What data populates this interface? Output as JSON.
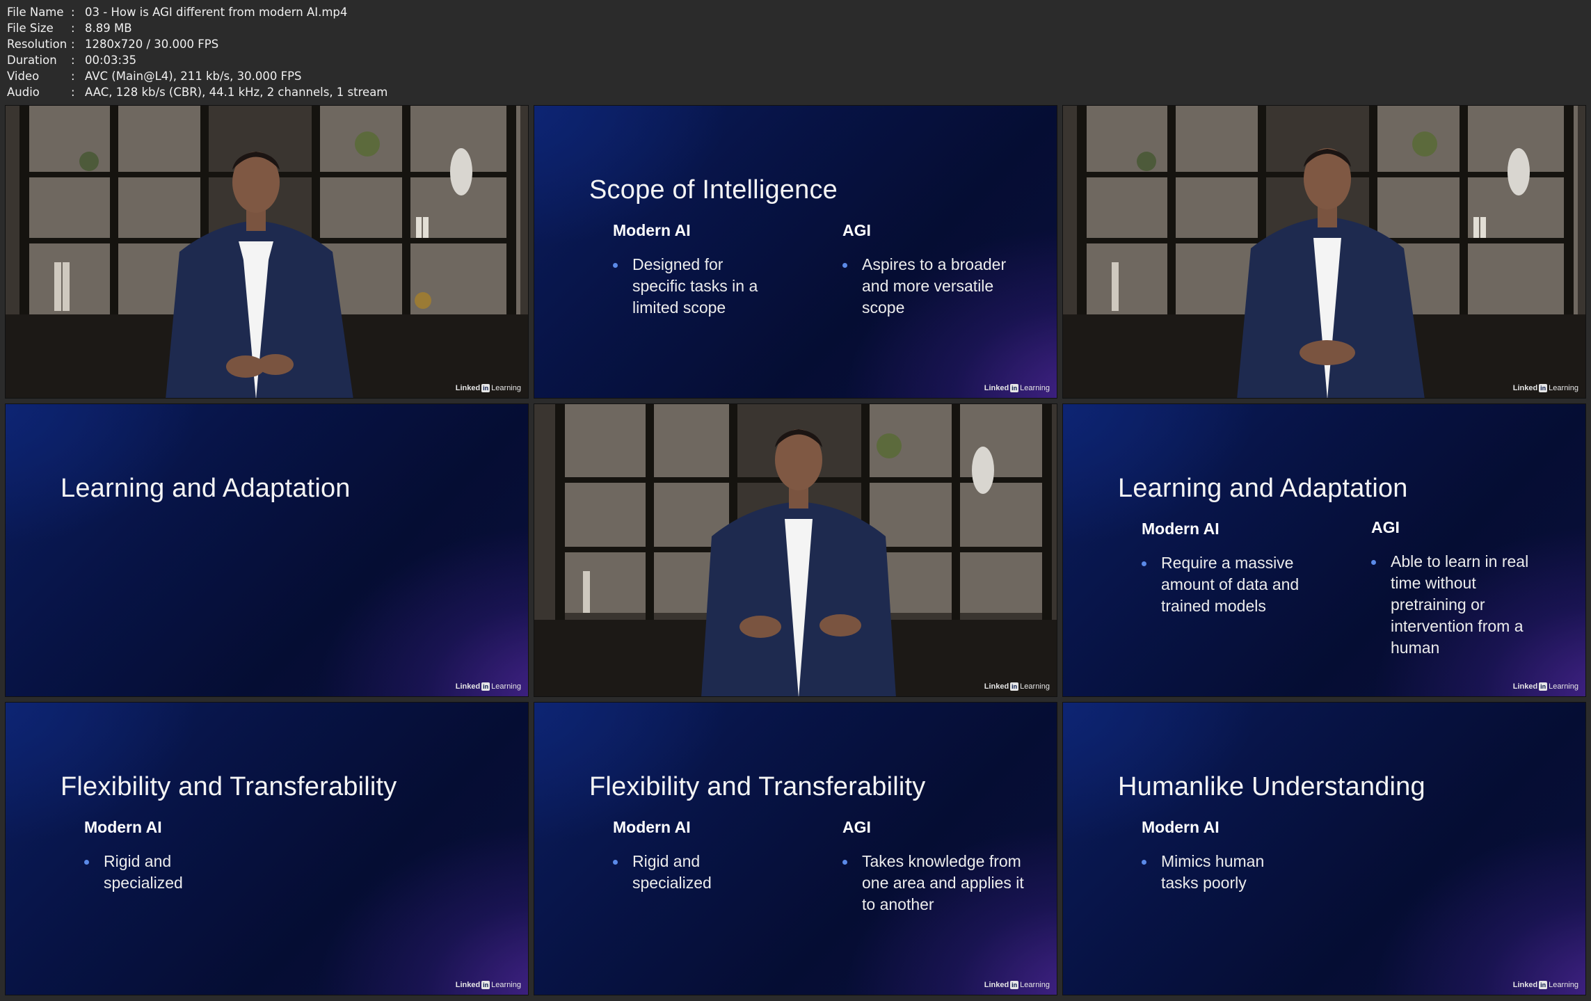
{
  "file_info": {
    "rows": [
      {
        "key": "File Name",
        "value": "03 - How is AGI different from modern AI.mp4"
      },
      {
        "key": "File Size",
        "value": "8.89 MB"
      },
      {
        "key": "Resolution",
        "value": "1280x720 / 30.000 FPS"
      },
      {
        "key": "Duration",
        "value": "00:03:35"
      },
      {
        "key": "Video",
        "value": "AVC (Main@L4), 211 kb/s, 30.000 FPS"
      },
      {
        "key": "Audio",
        "value": "AAC, 128 kb/s (CBR), 44.1 kHz, 2 channels, 1 stream"
      }
    ]
  },
  "brand": {
    "linked": "Linked",
    "in": "in",
    "learning": "Learning"
  },
  "slides": {
    "scope": {
      "title": "Scope of Intelligence",
      "left_head": "Modern AI",
      "left_bullets": [
        "Designed for specific tasks in a limited scope"
      ],
      "right_head": "AGI",
      "right_bullets": [
        "Aspires to a broader and more versatile scope"
      ]
    },
    "learning_title_only": {
      "title": "Learning and Adaptation"
    },
    "learning": {
      "title": "Learning and Adaptation",
      "left_head": "Modern AI",
      "left_bullets": [
        "Require a massive amount of data and trained models"
      ],
      "right_head": "AGI",
      "right_bullets": [
        "Able to learn in real time without pretraining or intervention from a human"
      ]
    },
    "flex_left": {
      "title": "Flexibility and Transferability",
      "left_head": "Modern AI",
      "left_bullets": [
        "Rigid and specialized"
      ]
    },
    "flex_full": {
      "title": "Flexibility and Transferability",
      "left_head": "Modern AI",
      "left_bullets": [
        "Rigid and specialized"
      ],
      "right_head": "AGI",
      "right_bullets": [
        "Takes knowledge from one area and applies it to another"
      ]
    },
    "humanlike": {
      "title": "Humanlike Understanding",
      "left_head": "Modern AI",
      "left_bullets": [
        "Mimics human tasks poorly"
      ]
    }
  },
  "colors": {
    "bullet": "#5b8ae8",
    "slide_bg": "#071345",
    "accent_purple": "#4e2696"
  }
}
